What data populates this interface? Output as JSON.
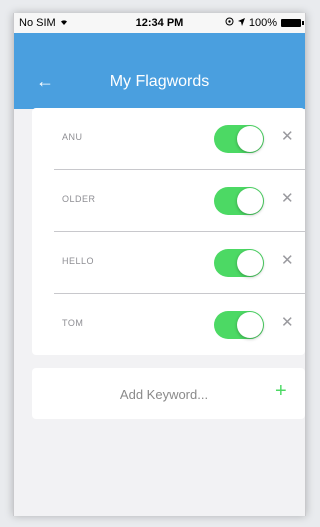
{
  "status_bar": {
    "carrier": "No SIM",
    "time": "12:34 PM",
    "battery": "100%"
  },
  "header": {
    "title": "My Flagwords",
    "back_icon": "←"
  },
  "keywords": [
    {
      "label": "ANU",
      "enabled": true
    },
    {
      "label": "OLDER",
      "enabled": true
    },
    {
      "label": "HELLO",
      "enabled": true
    },
    {
      "label": "TOM",
      "enabled": true
    }
  ],
  "add": {
    "placeholder": "Add Keyword...",
    "plus_icon": "+"
  },
  "colors": {
    "header": "#4a9fdf",
    "toggle_on": "#4cd964",
    "background": "#f2f2f4"
  }
}
